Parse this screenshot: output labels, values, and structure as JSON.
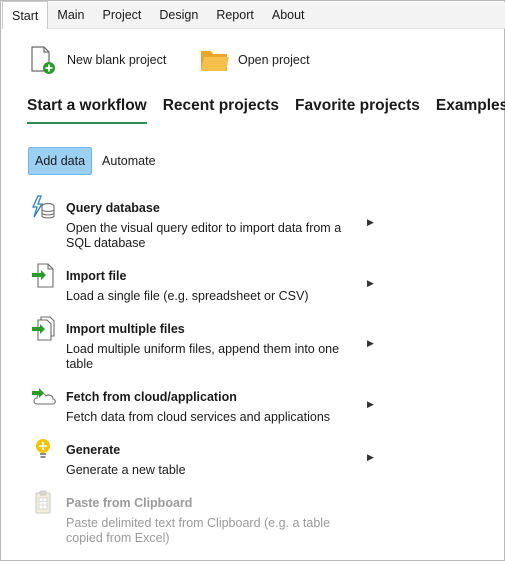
{
  "menu": {
    "tabs": [
      "Start",
      "Main",
      "Project",
      "Design",
      "Report",
      "About"
    ],
    "active": "Start"
  },
  "top_actions": {
    "new_blank_project": "New blank project",
    "open_project": "Open project"
  },
  "section_tabs": [
    "Start a workflow",
    "Recent projects",
    "Favorite projects",
    "Examples"
  ],
  "sub_tabs": {
    "add_data": "Add data",
    "automate": "Automate"
  },
  "items": [
    {
      "icon": "query-database-icon",
      "title": "Query database",
      "desc": "Open the visual query editor to import data from a SQL database",
      "enabled": true
    },
    {
      "icon": "import-file-icon",
      "title": "Import file",
      "desc": "Load a single file (e.g. spreadsheet or CSV)",
      "enabled": true
    },
    {
      "icon": "import-multiple-files-icon",
      "title": "Import multiple files",
      "desc": "Load multiple uniform files, append them into one table",
      "enabled": true
    },
    {
      "icon": "cloud-fetch-icon",
      "title": "Fetch from cloud/application",
      "desc": "Fetch data from cloud services and applications",
      "enabled": true
    },
    {
      "icon": "lightbulb-icon",
      "title": "Generate",
      "desc": "Generate a new table",
      "enabled": true
    },
    {
      "icon": "clipboard-icon",
      "title": "Paste from Clipboard",
      "desc": "Paste delimited text from Clipboard (e.g. a table copied from Excel)",
      "enabled": false
    }
  ],
  "colors": {
    "accent_underline": "#2e8b57",
    "active_subtab": "#9bd0f2",
    "green_arrow": "#2a9a2a",
    "folder": "#f3b53f",
    "bulb": "#f5c400",
    "disabled_text": "#9a9a9a"
  }
}
